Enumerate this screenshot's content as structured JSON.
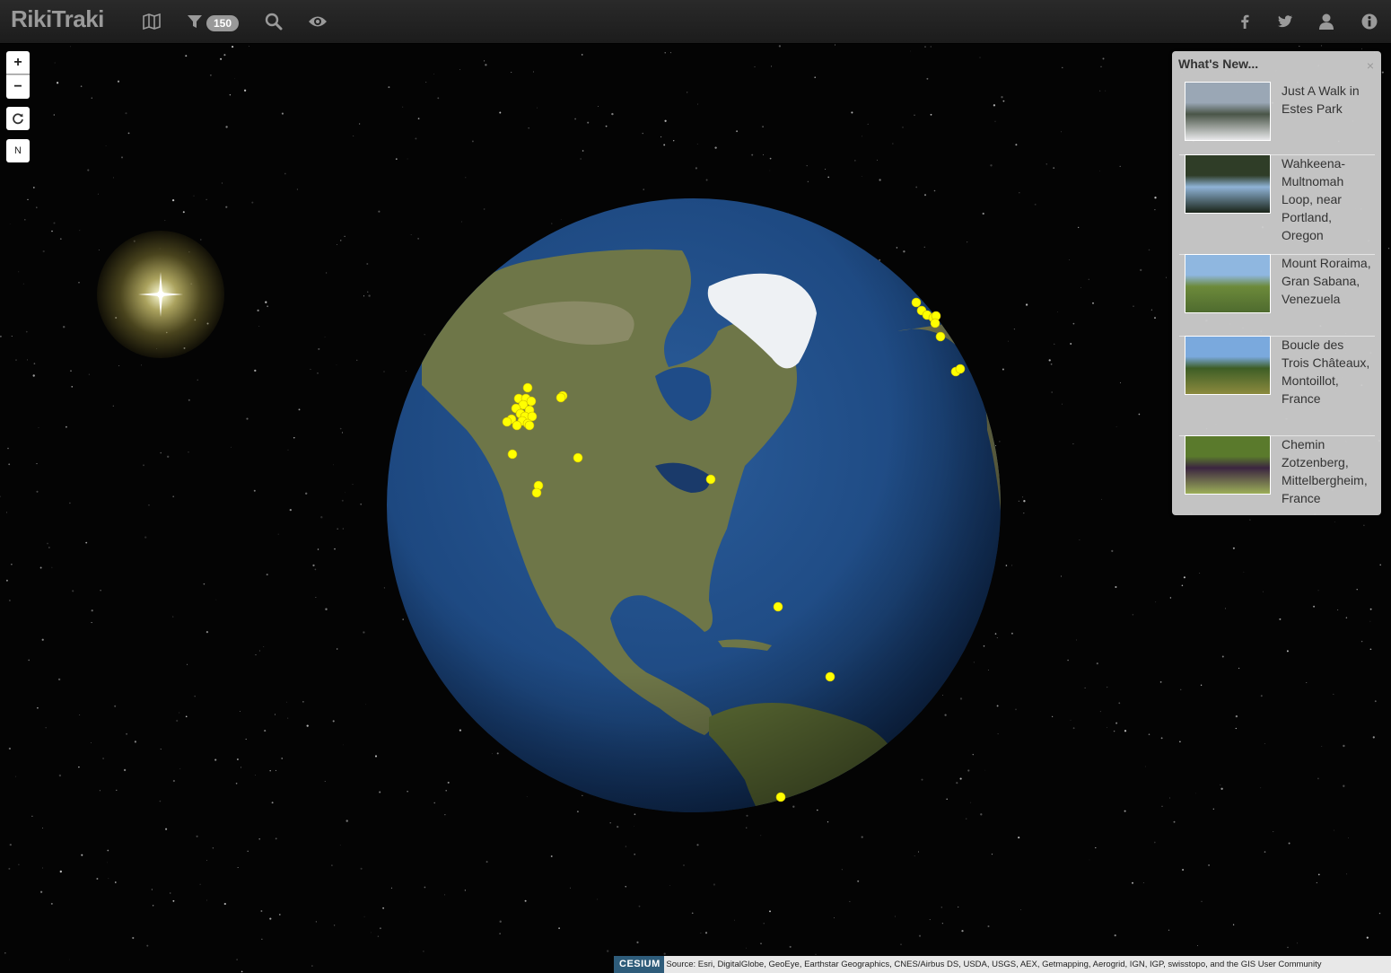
{
  "app": {
    "brand": "RikiTraki",
    "filter_count": "150"
  },
  "nav": {
    "left_icons": [
      "map-icon",
      "filter-icon",
      "search-icon",
      "eye-icon"
    ],
    "right_icons": [
      "facebook-icon",
      "twitter-icon",
      "user-icon",
      "info-icon"
    ]
  },
  "map_controls": {
    "zoom_in": "+",
    "zoom_out": "−",
    "reset_icon": "refresh-icon",
    "north": "N"
  },
  "whats_new": {
    "title": "What's New...",
    "close": "×",
    "items": [
      {
        "label": "Just A Walk in Estes Park",
        "thumb_colors": [
          "#9aa7b5",
          "#4a5548",
          "#e8e8ea"
        ]
      },
      {
        "label": "Wahkeena-Multnomah Loop, near Portland, Oregon",
        "thumb_colors": [
          "#2f3d27",
          "#8fb3d6",
          "#1a2418"
        ]
      },
      {
        "label": "Mount Roraima, Gran Sabana, Venezuela",
        "thumb_colors": [
          "#8fb7e0",
          "#6c8a3a",
          "#4f6b2f"
        ]
      },
      {
        "label": "Boucle des Trois Châteaux, Montoillot, France",
        "thumb_colors": [
          "#7aa9dd",
          "#3e5e26",
          "#8c8a3e"
        ]
      },
      {
        "label": "Chemin Zotzenberg, Mittelbergheim, France",
        "thumb_colors": [
          "#5a7a2c",
          "#3b2540",
          "#9cae58"
        ]
      }
    ]
  },
  "attribution": {
    "logo": "CESIUM",
    "text": "Source: Esri, DigitalGlobe, GeoEye, Earthstar Geographics, CNES/Airbus DS, USDA, USGS, AEX, Getmapping, Aerogrid, IGN, IGP, swisstopo, and the GIS User Community"
  },
  "colors": {
    "marker": "#ffff00",
    "ocean": "#1f4a86",
    "land": "#6f7a4a",
    "ice": "#f2f4f6"
  }
}
